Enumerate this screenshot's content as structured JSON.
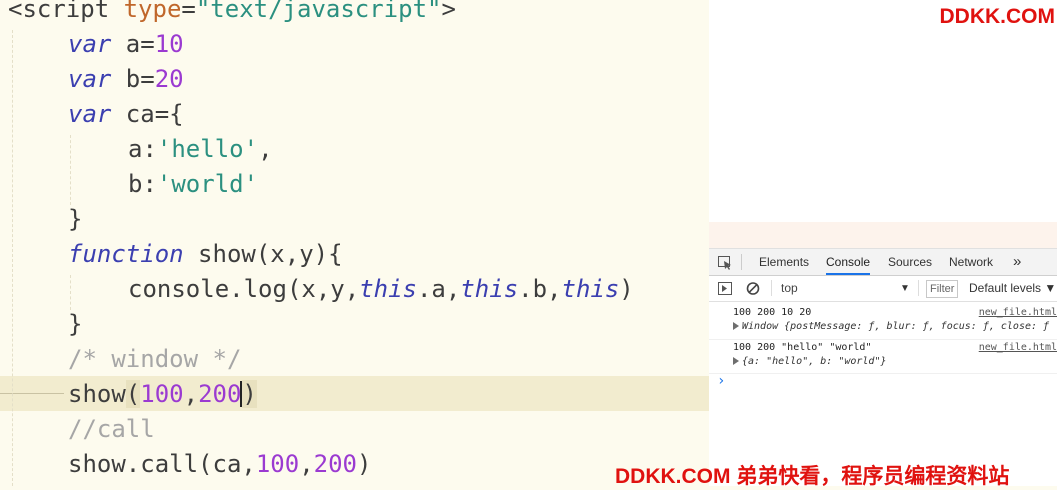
{
  "editor": {
    "lines": [
      {
        "parts": [
          {
            "t": "<script ",
            "c": "tag"
          },
          {
            "t": "type",
            "c": "attr"
          },
          {
            "t": "=",
            "c": ""
          },
          {
            "t": "\"text/javascript\"",
            "c": "str"
          },
          {
            "t": ">",
            "c": "tag"
          }
        ]
      },
      {
        "parts": [
          {
            "t": "var",
            "c": "kw"
          },
          {
            "t": " a=",
            "c": ""
          },
          {
            "t": "10",
            "c": "num"
          }
        ]
      },
      {
        "parts": [
          {
            "t": "var",
            "c": "kw"
          },
          {
            "t": " b=",
            "c": ""
          },
          {
            "t": "20",
            "c": "num"
          }
        ]
      },
      {
        "parts": [
          {
            "t": "var",
            "c": "kw"
          },
          {
            "t": " ca={",
            "c": ""
          }
        ]
      },
      {
        "parts": [
          {
            "t": "a:",
            "c": ""
          },
          {
            "t": "'hello'",
            "c": "str"
          },
          {
            "t": ",",
            "c": ""
          }
        ]
      },
      {
        "parts": [
          {
            "t": "b:",
            "c": ""
          },
          {
            "t": "'world'",
            "c": "str"
          }
        ]
      },
      {
        "parts": [
          {
            "t": "}",
            "c": ""
          }
        ]
      },
      {
        "parts": [
          {
            "t": "function",
            "c": "kw"
          },
          {
            "t": " show(x,y){",
            "c": ""
          }
        ]
      },
      {
        "parts": [
          {
            "t": "console.log(x,y,",
            "c": ""
          },
          {
            "t": "this",
            "c": "kw"
          },
          {
            "t": ".a,",
            "c": ""
          },
          {
            "t": "this",
            "c": "kw"
          },
          {
            "t": ".b,",
            "c": ""
          },
          {
            "t": "this",
            "c": "kw"
          },
          {
            "t": ")",
            "c": ""
          }
        ]
      },
      {
        "parts": [
          {
            "t": "}",
            "c": ""
          }
        ]
      },
      {
        "parts": [
          {
            "t": "/* window */",
            "c": "cmt"
          }
        ]
      },
      {
        "parts": [
          {
            "t": "show",
            "c": ""
          },
          {
            "t": "(",
            "c": "brk"
          },
          {
            "t": "100",
            "c": "num"
          },
          {
            "t": ",",
            "c": ""
          },
          {
            "t": "200",
            "c": "num"
          },
          {
            "t": "CARET",
            "c": "caret"
          },
          {
            "t": ")",
            "c": "brk"
          }
        ]
      },
      {
        "parts": [
          {
            "t": "//call",
            "c": "cmt"
          }
        ]
      },
      {
        "parts": [
          {
            "t": "show.call(ca,",
            "c": ""
          },
          {
            "t": "100",
            "c": "num"
          },
          {
            "t": ",",
            "c": ""
          },
          {
            "t": "200",
            "c": "num"
          },
          {
            "t": ")",
            "c": ""
          }
        ]
      }
    ]
  },
  "devtools": {
    "tabs": [
      "Elements",
      "Console",
      "Sources",
      "Network"
    ],
    "more": "»",
    "context": "top",
    "filter_placeholder": "Filter",
    "levels": "Default levels ▼",
    "messages": [
      {
        "line1": "100 200 10 20",
        "source": "new_file.html",
        "line2": "Window {postMessage: ƒ, blur: ƒ, focus: ƒ, close: ƒ"
      },
      {
        "line1": "100 200 \"hello\" \"world\"",
        "source": "new_file.html",
        "line2": "{a: \"hello\", b: \"world\"}"
      }
    ],
    "prompt": "›"
  },
  "watermark": {
    "top": "DDKK.COM",
    "bottom": "DDKK.COM 弟弟快看，程序员编程资料站"
  }
}
